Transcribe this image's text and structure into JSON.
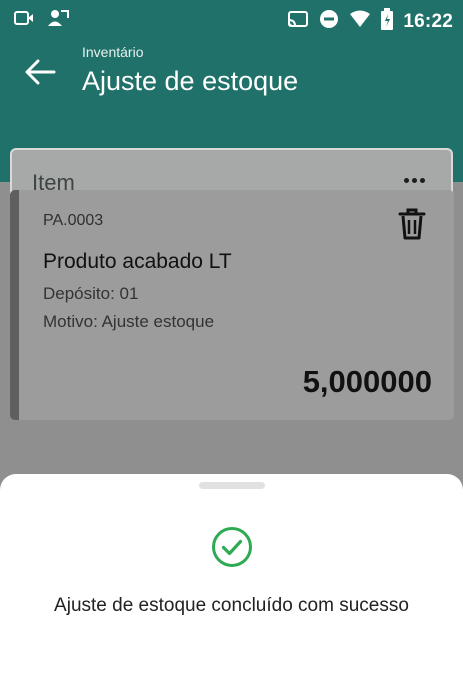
{
  "status_bar": {
    "time": "16:22",
    "left_icons": [
      "notification-screen-icon",
      "phone-call-icon"
    ],
    "right_icons": [
      "cast-icon",
      "do-not-disturb-icon",
      "wifi-icon",
      "battery-icon"
    ]
  },
  "header": {
    "subtitle": "Inventário",
    "title": "Ajuste de estoque"
  },
  "search": {
    "placeholder": "Item"
  },
  "item_card": {
    "code": "PA.0003",
    "name": "Produto acabado LT",
    "deposit": "Depósito: 01",
    "reason": "Motivo: Ajuste estoque",
    "quantity": "5,000000"
  },
  "dialog": {
    "message": "Ajuste de estoque concluído com sucesso",
    "icon": "check-circle-icon",
    "icon_color": "#2eaa52"
  },
  "colors": {
    "primary": "#1f7169",
    "overlay": "#8f8f8f"
  }
}
